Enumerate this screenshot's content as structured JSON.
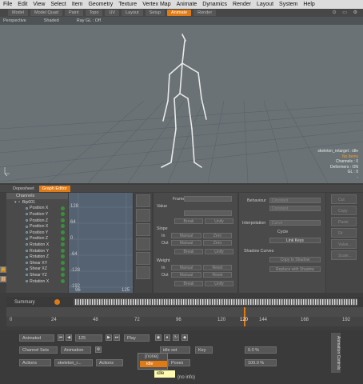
{
  "menubar": [
    "File",
    "Edit",
    "View",
    "Select",
    "Item",
    "Geometry",
    "Texture",
    "Vertex Map",
    "Animate",
    "Dynamics",
    "Render",
    "Layout",
    "System",
    "Help"
  ],
  "layout_tabs": [
    {
      "label": "Model",
      "active": false
    },
    {
      "label": "Model Quad",
      "active": false
    },
    {
      "label": "Paint",
      "active": false
    },
    {
      "label": "Topo",
      "active": false
    },
    {
      "label": "UV",
      "active": false
    },
    {
      "label": "Layout",
      "active": false
    },
    {
      "label": "Setup",
      "active": false
    },
    {
      "label": "Animate",
      "active": true
    },
    {
      "label": "Render",
      "active": false
    }
  ],
  "viewport": {
    "view": "Perspective",
    "shading": "Shaded",
    "rayGL": "Ray GL : Off",
    "info": [
      "skeleton_retarget : idle",
      "No Items",
      "Channels : 0",
      "Deformers : ON",
      "GL : 0",
      "-"
    ]
  },
  "panel_tabs": [
    {
      "label": "Dopesheet",
      "active": false
    },
    {
      "label": "Graph Editor",
      "active": true
    }
  ],
  "channels": {
    "header": "Channels",
    "root": "Bip001",
    "rows": [
      "Position X",
      "Position Y",
      "Position Z",
      "Position X",
      "Position Y",
      "Position Z",
      "Rotation X",
      "Rotation Y",
      "Rotation Z",
      "Shear XY",
      "Shear XZ",
      "Shear YZ",
      "Rotation X"
    ]
  },
  "graph": {
    "y_ticks": [
      "128",
      "64",
      "0",
      "-64",
      "-128",
      "-192"
    ],
    "x_ticks": [
      "96",
      "125"
    ]
  },
  "props": {
    "frame": "Frame",
    "value": "Value",
    "break": "Break",
    "unify": "Unify",
    "slope": "Slope",
    "weight": "Weight",
    "in": "In",
    "out": "Out",
    "manual": "Manual",
    "auto": "Auto",
    "zero": "Zero",
    "reset": "Reset"
  },
  "props2": {
    "behaviour": "Behaviour",
    "constant": "Constant",
    "interpolation": "Interpolation",
    "curve": "Curve",
    "cycle": "Cycle",
    "link_keys": "Link Keys",
    "shadow_curves": "Shadow Curves",
    "copy_to_shadow": "Copy to Shadow",
    "replace_with_shadow": "Replace with Shadow"
  },
  "rside": [
    "Cut",
    "Copy",
    "Paste",
    "Fit",
    "Value...",
    "Scale..."
  ],
  "summary_label": "Summary",
  "timeline": {
    "ticks": [
      "0",
      "24",
      "48",
      "72",
      "96",
      "120",
      "144",
      "168",
      "192"
    ],
    "current": "120"
  },
  "transport": {
    "mode": "Animated",
    "frame": "125",
    "play": "Play",
    "channel_sets": "Channel Sets",
    "animation": "Animation",
    "actions": "Actions",
    "actor": "skeleton_r...",
    "action_list": "Actions",
    "poses": "Poses",
    "idle_set": "idle set",
    "key": "Key",
    "pct1": "0.0 %",
    "pct2": "100.0 %",
    "none": "(none)",
    "idle": "idle",
    "no_info": "(no info)",
    "vertical": "Animation Controls"
  },
  "tooltip": "idle",
  "colors": {
    "accent": "#e07a14",
    "graph_bg": "#556272",
    "viewport_bg": "#6a7276"
  }
}
